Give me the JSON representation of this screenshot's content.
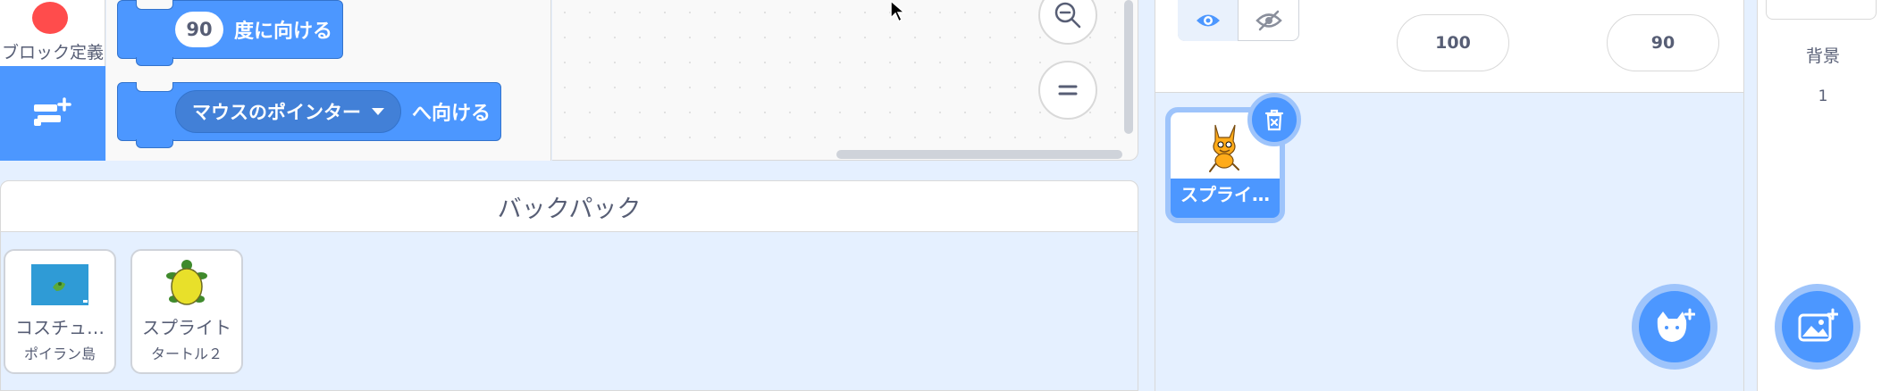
{
  "categories": {
    "my_blocks_label": "ブロック定義",
    "add_extension_icon": "add-extension-icon"
  },
  "blocks": {
    "point_in_direction": {
      "value": "90",
      "suffix": "度に向ける"
    },
    "point_towards": {
      "dropdown": "マウスのポインター",
      "suffix": "へ向ける"
    }
  },
  "backpack": {
    "title": "バックパック",
    "items": [
      {
        "title": "コスチュ…",
        "subtitle": "ポイラン島"
      },
      {
        "title": "スプライト",
        "subtitle": "タートル２"
      }
    ]
  },
  "sprite_info": {
    "size": "100",
    "direction": "90",
    "show_icon": "eye-icon",
    "hide_icon": "eye-slash-icon"
  },
  "sprites": [
    {
      "name": "スプライ…",
      "selected": true
    }
  ],
  "stage": {
    "label": "背景",
    "count": "1"
  },
  "colors": {
    "accent": "#4c97ff",
    "accent_border": "#3373cc",
    "ring": "#9ec4fb",
    "pane_bg": "#e5f0ff",
    "text": "#575e75",
    "red_category": "#ff4c4c"
  }
}
